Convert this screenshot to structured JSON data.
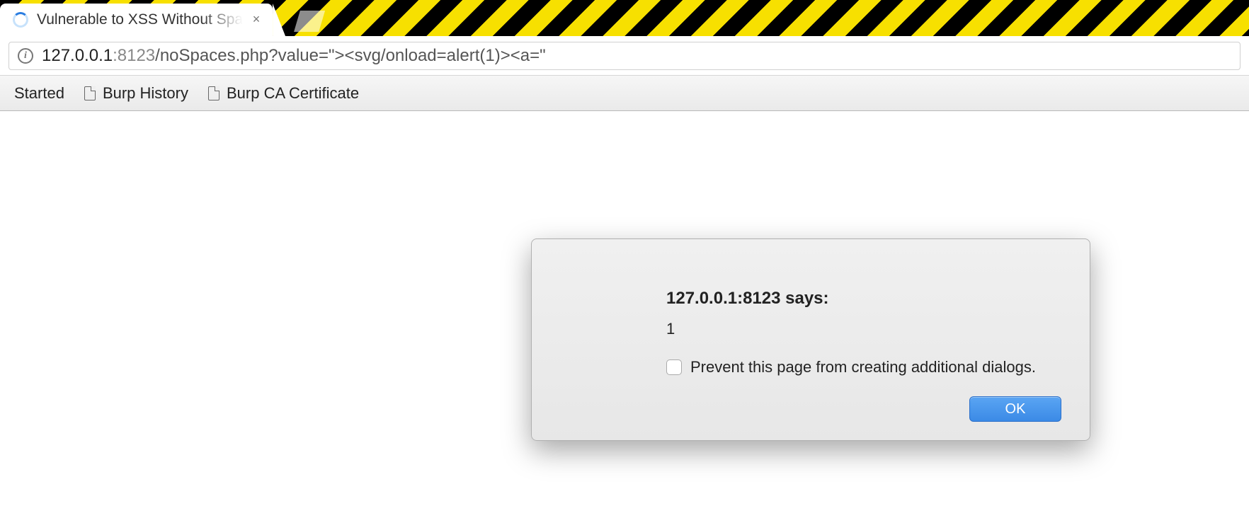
{
  "tab": {
    "title": "Vulnerable to XSS Without Spa",
    "close_glyph": "×"
  },
  "address": {
    "info_glyph": "i",
    "host": "127.0.0.1",
    "port": ":8123",
    "path": "/noSpaces.php?value=\"><svg/onload=alert(1)><a=\""
  },
  "bookmarks": {
    "items": [
      {
        "label": "Started"
      },
      {
        "label": "Burp History"
      },
      {
        "label": "Burp CA Certificate"
      }
    ]
  },
  "alert": {
    "title": "127.0.0.1:8123 says:",
    "message": "1",
    "prevent_label": "Prevent this page from creating additional dialogs.",
    "ok_label": "OK"
  }
}
